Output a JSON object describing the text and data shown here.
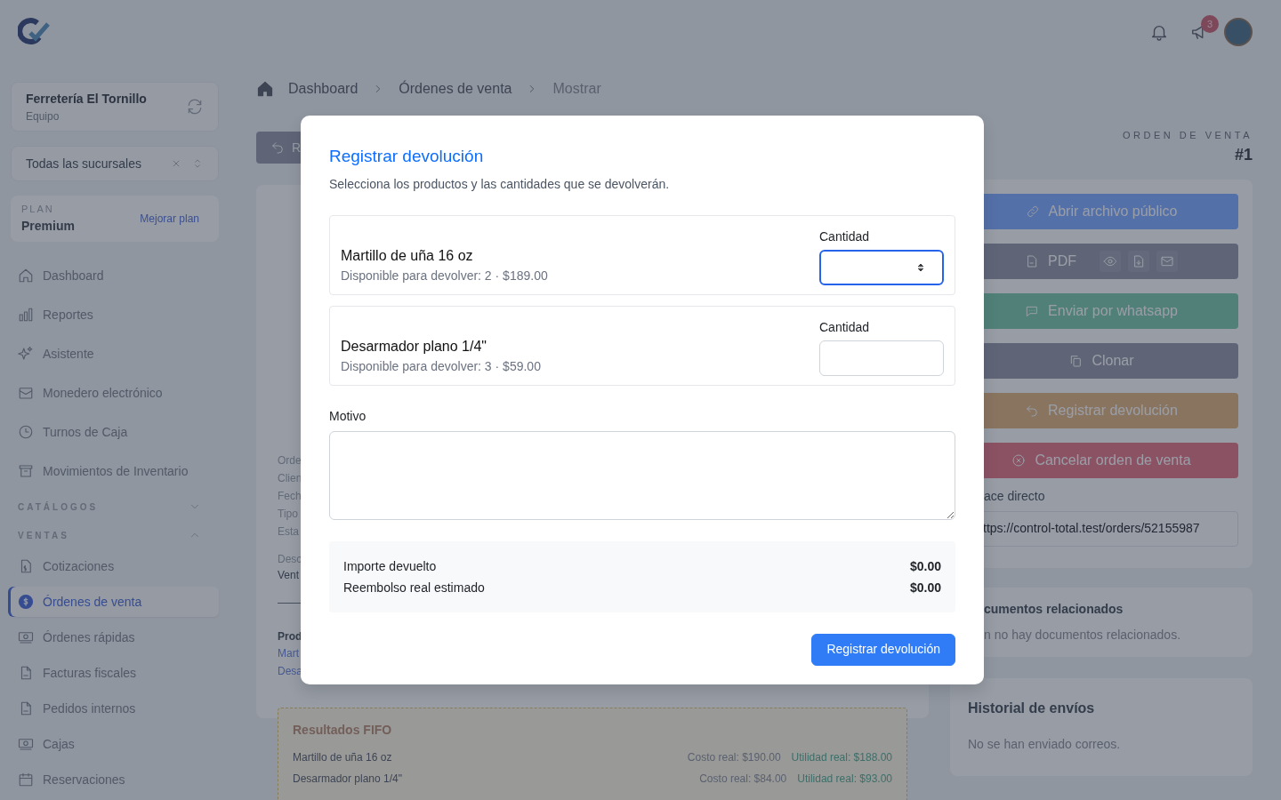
{
  "topbar": {
    "notifications_badge": "3"
  },
  "sidebar": {
    "team": {
      "name": "Ferretería El Tornillo",
      "role": "Equipo"
    },
    "branch_select": {
      "value": "Todas las sucursales"
    },
    "plan": {
      "label": "PLAN",
      "name": "Premium",
      "upgrade": "Mejorar plan"
    },
    "items": [
      {
        "label": "Dashboard",
        "selected": false
      },
      {
        "label": "Reportes",
        "selected": false
      },
      {
        "label": "Asistente",
        "selected": false
      },
      {
        "label": "Monedero electrónico",
        "selected": false
      },
      {
        "label": "Turnos de Caja",
        "selected": false
      },
      {
        "label": "Movimientos de Inventario",
        "selected": false
      }
    ],
    "sections": [
      {
        "title": "CATÁLOGOS",
        "expanded": false
      },
      {
        "title": "VENTAS",
        "expanded": true,
        "items": [
          {
            "label": "Cotizaciones",
            "selected": false
          },
          {
            "label": "Órdenes de venta",
            "selected": true
          },
          {
            "label": "Órdenes rápidas",
            "selected": false
          },
          {
            "label": "Facturas fiscales",
            "selected": false
          },
          {
            "label": "Pedidos internos",
            "selected": false
          },
          {
            "label": "Cajas",
            "selected": false
          },
          {
            "label": "Reservaciones",
            "selected": false
          }
        ]
      }
    ]
  },
  "breadcrumb": [
    "Dashboard",
    "Órdenes de venta",
    "Mostrar"
  ],
  "order_header": {
    "label": "ORDEN DE VENTA",
    "number": "#1"
  },
  "main": {
    "action_button": "R",
    "details": [
      "Orde",
      "Clien",
      "Fech",
      "Tipo",
      "Esta"
    ],
    "description_label": "Desc",
    "description": "Vent",
    "products_label": "Prod",
    "products": [
      "Mart",
      "Desa"
    ],
    "fifo": {
      "title": "Resultados FIFO",
      "rows": [
        {
          "name": "Martillo de uña 16 oz",
          "cost": "Costo real: $190.00",
          "profit": "Utilidad real: $188.00"
        },
        {
          "name": "Desarmador plano 1/4\"",
          "cost": "Costo real: $84.00",
          "profit": "Utilidad real: $93.00"
        }
      ]
    }
  },
  "actions": [
    {
      "label": "Abrir archivo público"
    },
    {
      "label": "PDF"
    },
    {
      "label": "Enviar por whatsapp"
    },
    {
      "label": "Clonar"
    },
    {
      "label": "Registrar devolución"
    },
    {
      "label": "Cancelar orden de venta"
    }
  ],
  "direct_link": {
    "label": "ace directo",
    "value": "ttps://control-total.test/orders/52155987"
  },
  "related_docs": {
    "title": "cumentos relacionados",
    "empty": "n no hay documentos relacionados."
  },
  "send_history": {
    "title": "Historial de envíos",
    "empty": "No se han enviado correos."
  },
  "modal": {
    "title": "Registrar devolución",
    "subtitle": "Selecciona los productos y las cantidades que se devolverán.",
    "products": [
      {
        "name": "Martillo de uña 16 oz",
        "available": "Disponible para devolver: 2 · $189.00",
        "quantity_label": "Cantidad",
        "focused": true
      },
      {
        "name": "Desarmador plano 1/4\"",
        "available": "Disponible para devolver: 3 · $59.00",
        "quantity_label": "Cantidad",
        "focused": false
      }
    ],
    "reason_label": "Motivo",
    "totals": [
      {
        "label": "Importe devuelto",
        "value": "$0.00"
      },
      {
        "label": "Reembolso real estimado",
        "value": "$0.00"
      }
    ],
    "submit": "Registrar devolución"
  }
}
